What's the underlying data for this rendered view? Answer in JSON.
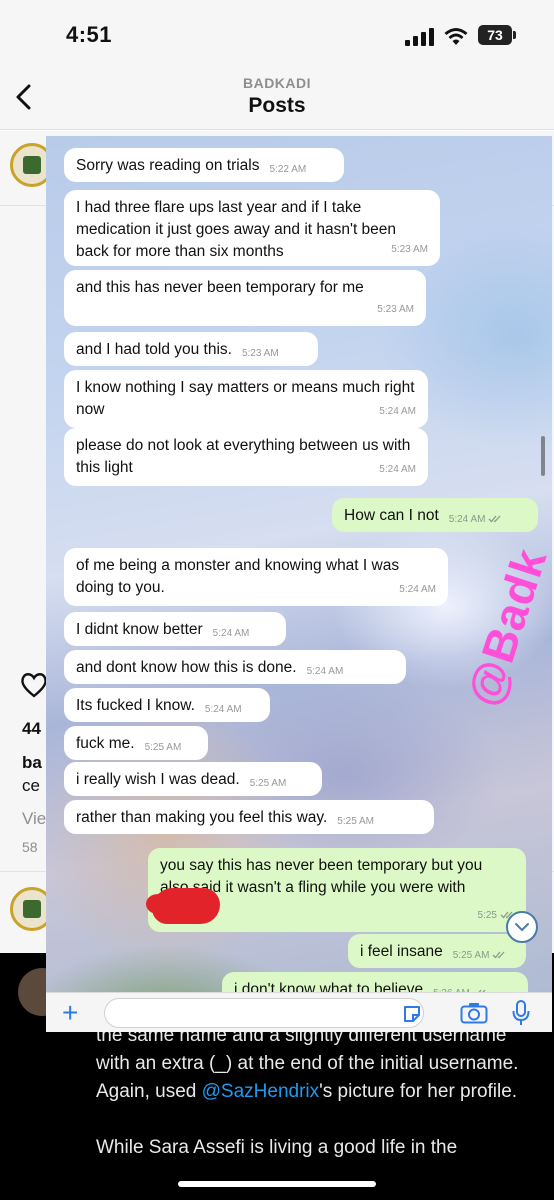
{
  "status_bar": {
    "time": "4:51",
    "battery": "73"
  },
  "header": {
    "username": "BADKADI",
    "title": "Posts"
  },
  "feed": {
    "like_count_fragment": "44",
    "caption_fragment_1": "ba",
    "caption_fragment_2": "ce",
    "view_fragment": "Vie",
    "date_fragment": "58"
  },
  "chat": {
    "watermark": "@Badk",
    "messages": [
      {
        "text": "Sorry was reading on trials",
        "time": "5:22 AM",
        "dir": "in"
      },
      {
        "text": "I had three flare ups last year and if I take medication it just goes away and it hasn't been back for more than six months",
        "time": "5:23 AM",
        "dir": "in"
      },
      {
        "text": "and this has never been temporary for me",
        "time": "5:23 AM",
        "dir": "in"
      },
      {
        "text": "and I had told you this.",
        "time": "5:23 AM",
        "dir": "in"
      },
      {
        "text": "I know nothing I say matters or means much right now",
        "time": "5:24 AM",
        "dir": "in"
      },
      {
        "text": "please do not look at everything between us with this light",
        "time": "5:24 AM",
        "dir": "in"
      },
      {
        "text": "How can I not",
        "time": "5:24 AM",
        "dir": "out"
      },
      {
        "text": "of me being a monster and knowing what I was doing to you.",
        "time": "5:24 AM",
        "dir": "in"
      },
      {
        "text": "I didnt know better",
        "time": "5:24 AM",
        "dir": "in"
      },
      {
        "text": "and dont know how this is done.",
        "time": "5:24 AM",
        "dir": "in"
      },
      {
        "text": "Its fucked I know.",
        "time": "5:24 AM",
        "dir": "in"
      },
      {
        "text": "fuck me.",
        "time": "5:25 AM",
        "dir": "in"
      },
      {
        "text": "i really wish I was dead.",
        "time": "5:25 AM",
        "dir": "in"
      },
      {
        "text": "rather than making you feel this way.",
        "time": "5:25 AM",
        "dir": "in"
      },
      {
        "text": "you say this has never been temporary but you also said it wasn't a fling while you were with",
        "time": "5:25",
        "dir": "out"
      },
      {
        "text": "i feel insane",
        "time": "5:25 AM",
        "dir": "out"
      },
      {
        "text": "i don't know what to believe",
        "time": "5:26 AM",
        "dir": "out"
      }
    ]
  },
  "tweet": {
    "line_1": "the same name and a slightly different username with an extra (_) at the end of the initial username. Again, used",
    "mention": "@SazHendrix",
    "line_1_end": "'s picture for her profile.",
    "line_2": "While Sara Assefi is living a good life in the"
  }
}
